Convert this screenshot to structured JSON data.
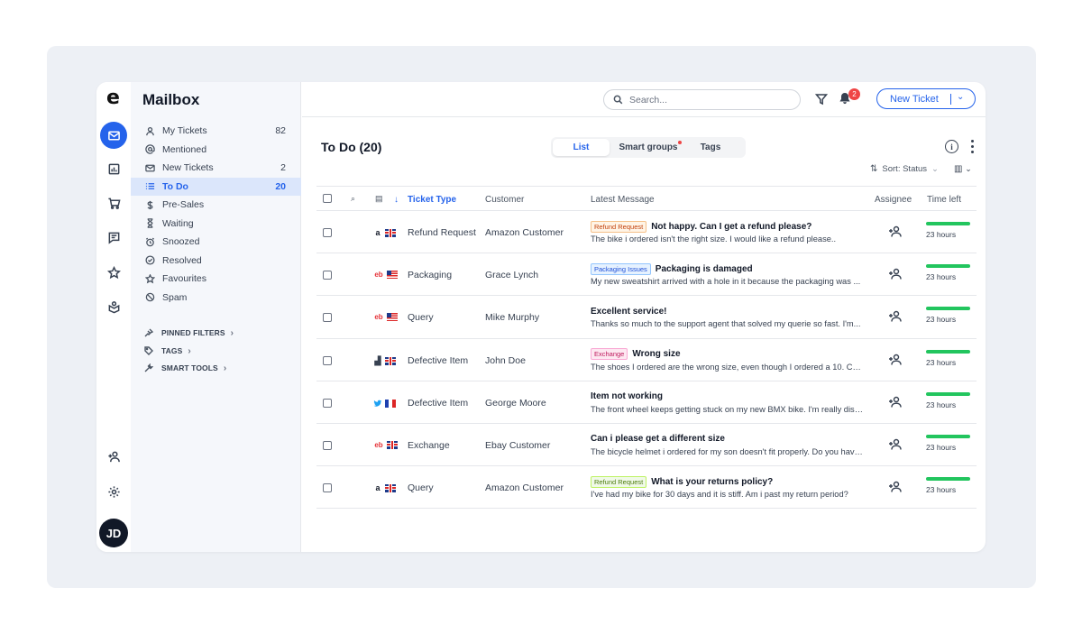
{
  "app": {
    "logo": "e",
    "title": "Mailbox"
  },
  "rail": {
    "avatar_initials": "JD"
  },
  "topbar": {
    "search_placeholder": "Search...",
    "notification_count": "2",
    "new_ticket_label": "New Ticket"
  },
  "sidebar": {
    "items": [
      {
        "label": "My Tickets",
        "count": "82",
        "icon": "user-icon"
      },
      {
        "label": "Mentioned",
        "count": "",
        "icon": "at-icon"
      },
      {
        "label": "New Tickets",
        "count": "2",
        "icon": "mail-icon"
      },
      {
        "label": "To Do",
        "count": "20",
        "icon": "list-icon",
        "active": true
      },
      {
        "label": "Pre-Sales",
        "count": "",
        "icon": "dollar-icon"
      },
      {
        "label": "Waiting",
        "count": "",
        "icon": "hourglass-icon"
      },
      {
        "label": "Snoozed",
        "count": "",
        "icon": "alarm-icon"
      },
      {
        "label": "Resolved",
        "count": "",
        "icon": "check-circle-icon"
      },
      {
        "label": "Favourites",
        "count": "",
        "icon": "star-icon"
      },
      {
        "label": "Spam",
        "count": "",
        "icon": "ban-icon"
      }
    ],
    "sections": [
      "PINNED FILTERS",
      "TAGS",
      "SMART TOOLS"
    ]
  },
  "main": {
    "title": "To Do (20)",
    "tabs": [
      "List",
      "Smart groups",
      "Tags"
    ],
    "sort_label": "Sort: Status",
    "columns": [
      "Ticket Type",
      "Customer",
      "Latest Message",
      "Assignee",
      "Time left"
    ]
  },
  "tickets": [
    {
      "source": "a",
      "flag": "uk",
      "type": "Refund Request",
      "customer": "Amazon Customer",
      "tag": "Refund Request",
      "tag_style": "orange",
      "subject": "Not happy. Can I get a refund please?",
      "preview": "The bike i ordered isn't the right size. I would like a refund please..",
      "time_left": "23 hours"
    },
    {
      "source": "eb",
      "flag": "us",
      "type": "Packaging",
      "customer": "Grace Lynch",
      "tag": "Packaging Issues",
      "tag_style": "blue",
      "subject": "Packaging is damaged",
      "preview": "My new sweatshirt arrived with a hole in it because the packaging was ...",
      "time_left": "23 hours"
    },
    {
      "source": "eb",
      "flag": "us",
      "type": "Query",
      "customer": "Mike Murphy",
      "tag": "",
      "tag_style": "",
      "subject": "Excellent service!",
      "preview": "Thanks so much to the support agent that solved my querie so fast. I'm...",
      "time_left": "23 hours"
    },
    {
      "source": "bars",
      "flag": "uk",
      "type": "Defective Item",
      "customer": "John Doe",
      "tag": "Exchange",
      "tag_style": "pink",
      "subject": "Wrong size",
      "preview": "The shoes I ordered are the wrong size, even though I ordered a 10. Can I...",
      "time_left": "23 hours"
    },
    {
      "source": "tw",
      "flag": "fr",
      "type": "Defective Item",
      "customer": "George Moore",
      "tag": "",
      "tag_style": "",
      "subject": "Item not working",
      "preview": "The front wheel keeps getting stuck on my new BMX bike. I'm really disa...",
      "time_left": "23 hours"
    },
    {
      "source": "eb",
      "flag": "uk",
      "type": "Exchange",
      "customer": "Ebay Customer",
      "tag": "",
      "tag_style": "",
      "subject": "Can i please get a different size",
      "preview": "The bicycle helmet i ordered for my son doesn't fit properly. Do you have...",
      "time_left": "23 hours"
    },
    {
      "source": "a",
      "flag": "uk",
      "type": "Query",
      "customer": "Amazon Customer",
      "tag": "Refund Request",
      "tag_style": "green",
      "subject": "What is your returns policy?",
      "preview": "I've had my bike for 30 days and it is stiff. Am i past my return period?",
      "time_left": "23 hours"
    }
  ],
  "colors": {
    "accent": "#2563eb",
    "progress": "#22c55e",
    "badge": "#ef4444"
  }
}
